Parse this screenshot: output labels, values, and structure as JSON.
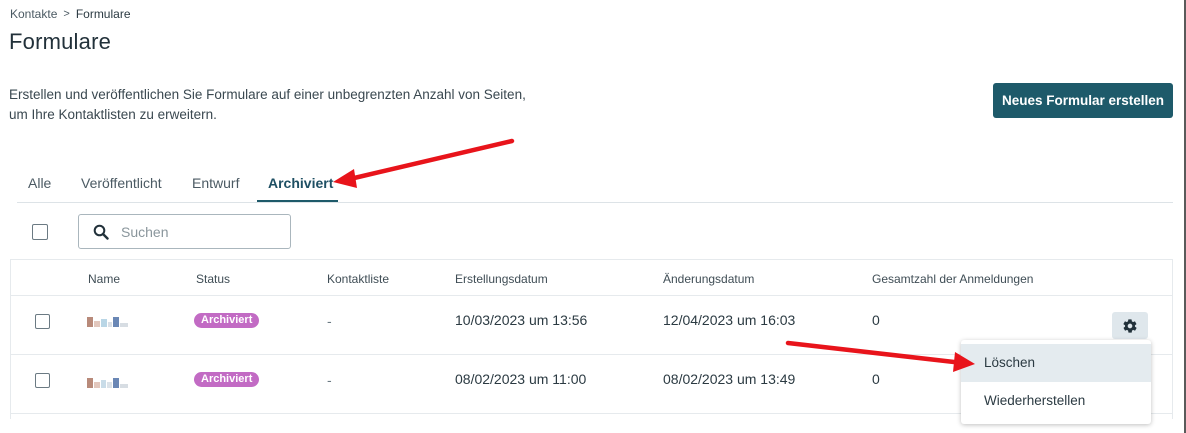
{
  "breadcrumb": {
    "parent": "Kontakte",
    "separator": ">",
    "current": "Formulare"
  },
  "page": {
    "title": "Formulare",
    "description_line1": "Erstellen und veröffentlichen Sie Formulare auf einer unbegrenzten Anzahl von Seiten,",
    "description_line2": "um Ihre Kontaktlisten zu erweitern.",
    "new_form_label": "Neues Formular erstellen"
  },
  "tabs": [
    {
      "label": "Alle"
    },
    {
      "label": "Veröffentlicht"
    },
    {
      "label": "Entwurf"
    },
    {
      "label": "Archiviert",
      "active": true
    }
  ],
  "search": {
    "placeholder": "Suchen",
    "value": ""
  },
  "table": {
    "columns": [
      "Name",
      "Status",
      "Kontaktliste",
      "Erstellungsdatum",
      "Änderungsdatum",
      "Gesamtzahl der Anmeldungen"
    ],
    "rows": [
      {
        "status": "Archiviert",
        "contact_list": "-",
        "created": "10/03/2023 um 13:56",
        "modified": "12/04/2023 um 16:03",
        "signups": "0"
      },
      {
        "status": "Archiviert",
        "contact_list": "-",
        "created": "08/02/2023 um 11:00",
        "modified": "08/02/2023 um 13:49",
        "signups": "0"
      }
    ]
  },
  "row_menu": {
    "items": [
      {
        "label": "Löschen"
      },
      {
        "label": "Wiederherstellen"
      }
    ]
  },
  "colors": {
    "primary": "#1e5a6a",
    "badge": "#c26bc4",
    "annotation_arrow": "#e8141b"
  },
  "icons": {
    "search": "search-icon",
    "settings": "gear-icon"
  }
}
